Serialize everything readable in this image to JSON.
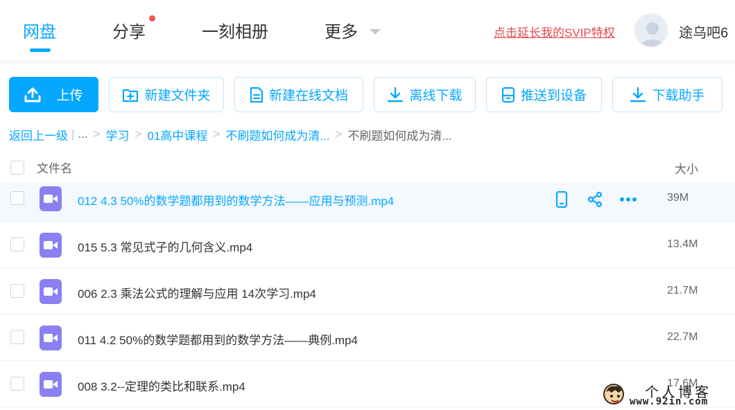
{
  "nav": {
    "tabs": [
      {
        "label": "网盘",
        "active": true
      },
      {
        "label": "分享",
        "badge": true
      },
      {
        "label": "一刻相册"
      },
      {
        "label": "更多",
        "dropdown": true
      }
    ],
    "svip_link": "点击延长我的SVIP特权",
    "username": "途乌吧6",
    "avatar_icon": "user-avatar-icon"
  },
  "toolbar": {
    "upload": "上传",
    "new_folder": "新建文件夹",
    "new_online_doc": "新建在线文档",
    "offline_download": "离线下载",
    "push_to_device": "推送到设备",
    "download_helper": "下载助手"
  },
  "breadcrumb": {
    "back": "返回上一级",
    "ellipsis": "...",
    "items": [
      "学习",
      "01高中课程",
      "不刷题如何成为清..."
    ],
    "current": "不刷题如何成为清..."
  },
  "table": {
    "col_name": "文件名",
    "col_size": "大小",
    "rows": [
      {
        "name": "012 4.3 50%的数学题都用到的数学方法——应用与预测.mp4",
        "size": "39M",
        "hover": true
      },
      {
        "name": "015 5.3 常见式子的几何含义.mp4",
        "size": "13.4M"
      },
      {
        "name": "006 2.3 乘法公式的理解与应用 14次学习.mp4",
        "size": "21.7M"
      },
      {
        "name": "011 4.2 50%的数学题都用到的数学方法——典例.mp4",
        "size": "22.7M"
      },
      {
        "name": "008 3.2--定理的类比和联系.mp4",
        "size": "17.6M"
      }
    ]
  },
  "watermark": {
    "title": "个人博客",
    "url": "www.92in.com"
  },
  "colors": {
    "accent": "#06a7ff",
    "svip_red": "#e5484d",
    "video_icon": "#8a80f2",
    "badge_red": "#f5534f"
  }
}
